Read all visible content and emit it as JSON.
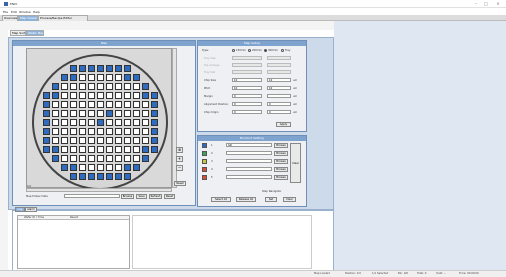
{
  "window": {
    "title": "ENDi",
    "min": "–",
    "max": "□",
    "close": "×"
  },
  "menu": [
    "File",
    "Edit",
    "Window",
    "Help"
  ],
  "tabs": [
    "Overview",
    "Map Viewer",
    "Process/Recipe Editor"
  ],
  "subtabs": [
    "Map Sort",
    "Wafer Map"
  ],
  "map_panel": {
    "title": "Map",
    "corner_label": "0,0",
    "map_prober_label": "Map Prober Data",
    "browse_label": "Browse",
    "save_label": "Save",
    "refresh_label": "Refresh",
    "reset_label": "Reset",
    "side_reset_label": "Reset"
  },
  "die_map": {
    "rows": [
      "..........BBBB..........",
      ".........",
      "BBBBBBBBB",
      "BWWWWWWWWB",
      "BWWWWWWWWWWB",
      "BWWWWWWWWWWB",
      "BWWWWWBWWWWB",
      "BWWWWWWWWWWB",
      "BWWWWWWWWWWB",
      "BWWWWWWWWB",
      "BWWWWWWB",
      "BBBBBB"
    ]
  },
  "settings_panel": {
    "title": "Map Setup",
    "type_label": "Type:",
    "type_options": [
      "150mm",
      "200mm",
      "300mm",
      "Tray"
    ],
    "type_selected": 2,
    "disabled_rows": [
      "Tray Size",
      "Die Arrange",
      "Tray Dist"
    ],
    "rows": [
      {
        "label": "Chip Size",
        "v1": "10",
        "v2": "10",
        "unit": "um"
      },
      {
        "label": "Pitch",
        "v1": "10",
        "v2": "10",
        "unit": "um"
      },
      {
        "label": "Margin",
        "v1": "0",
        "v2": "",
        "unit": "um"
      },
      {
        "label": "Alignment Position",
        "v1": "0",
        "v2": "0",
        "unit": "um"
      },
      {
        "label": "Chip Origin",
        "v1": "0",
        "v2": "0",
        "unit": "um"
      }
    ],
    "apply_label": "Apply"
  },
  "bin_panel": {
    "title": "Bin/Sort Setting",
    "bins": [
      {
        "num": "1",
        "name": "GD",
        "color": "#2d6cc0",
        "btn": "Browse"
      },
      {
        "num": "2",
        "name": "",
        "color": "#3aa35a",
        "btn": "Browse"
      },
      {
        "num": "3",
        "name": "",
        "color": "#c9c934",
        "btn": "Browse"
      },
      {
        "num": "4",
        "name": "",
        "color": "#e04a3a",
        "btn": "Browse"
      },
      {
        "num": "5",
        "name": "",
        "color": "#e04a3a",
        "btn": "Browse"
      }
    ],
    "side_label": "Clear",
    "select_all_label": "Select All",
    "release_label": "Release All",
    "set_label": "Set",
    "clear_label": "Clear",
    "step_label": "Step Navigator"
  },
  "bottom": {
    "tabs": [
      "Log",
      "Alarm"
    ],
    "col1": "Wafer ID / Time",
    "col2": "Result"
  },
  "status_bar": [
    "Map Loaded",
    "Position: 0,0",
    "1/1 Selected",
    "Bin: 0/0",
    "Total: 0",
    "Yield: --",
    "Time: 00:00:00"
  ]
}
